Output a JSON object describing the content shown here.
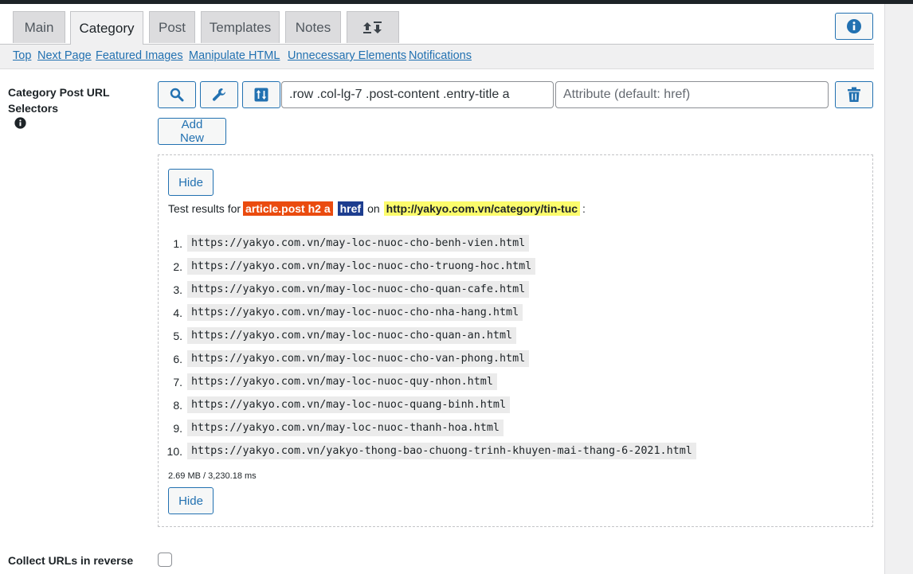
{
  "tabs": [
    {
      "label": "Main",
      "active": false
    },
    {
      "label": "Category",
      "active": true
    },
    {
      "label": "Post",
      "active": false
    },
    {
      "label": "Templates",
      "active": false
    },
    {
      "label": "Notes",
      "active": false
    },
    {
      "label": "",
      "icon": "import-export-icon",
      "active": false
    }
  ],
  "subnav": [
    "Top",
    "Next Page",
    "Featured Images",
    "Manipulate HTML",
    "Unnecessary Elements",
    "Notifications"
  ],
  "category_post_url": {
    "label_line1": "Category Post URL",
    "label_line2": "Selectors",
    "selector_value": ".row .col-lg-7 .post-content .entry-title a",
    "attribute_placeholder": "Attribute (default: href)",
    "add_new_label": "Add New"
  },
  "results": {
    "hide_label": "Hide",
    "prefix": "Test results for",
    "selector": "article.post h2 a",
    "attribute": "href",
    "on_word": "on",
    "url": "http://yakyo.com.vn/category/tin-tuc",
    "suffix": ":",
    "items": [
      {
        "n": "1.",
        "url": "https://yakyo.com.vn/may-loc-nuoc-cho-benh-vien.html"
      },
      {
        "n": "2.",
        "url": "https://yakyo.com.vn/may-loc-nuoc-cho-truong-hoc.html"
      },
      {
        "n": "3.",
        "url": "https://yakyo.com.vn/may-loc-nuoc-cho-quan-cafe.html"
      },
      {
        "n": "4.",
        "url": "https://yakyo.com.vn/may-loc-nuoc-cho-nha-hang.html"
      },
      {
        "n": "5.",
        "url": "https://yakyo.com.vn/may-loc-nuoc-cho-quan-an.html"
      },
      {
        "n": "6.",
        "url": "https://yakyo.com.vn/may-loc-nuoc-cho-van-phong.html"
      },
      {
        "n": "7.",
        "url": "https://yakyo.com.vn/may-loc-nuoc-quy-nhon.html"
      },
      {
        "n": "8.",
        "url": "https://yakyo.com.vn/may-loc-nuoc-quang-binh.html"
      },
      {
        "n": "9.",
        "url": "https://yakyo.com.vn/may-loc-nuoc-thanh-hoa.html"
      },
      {
        "n": "10.",
        "url": "https://yakyo.com.vn/yakyo-thong-bao-chuong-trinh-khuyen-mai-thang-6-2021.html"
      }
    ],
    "stats": "2.69 MB / 3,230.18 ms"
  },
  "collect_reverse": {
    "label": "Collect URLs in reverse",
    "checked": false
  },
  "icons": {
    "info": "info-icon",
    "search": "search-icon",
    "wrench": "wrench-icon",
    "sort": "sort-icon",
    "trash": "trash-icon"
  },
  "colors": {
    "accent": "#2271b1",
    "selector_tag": "#ea4b0f",
    "attribute_tag": "#1d3d8f",
    "url_tag": "#fcfc6c"
  }
}
